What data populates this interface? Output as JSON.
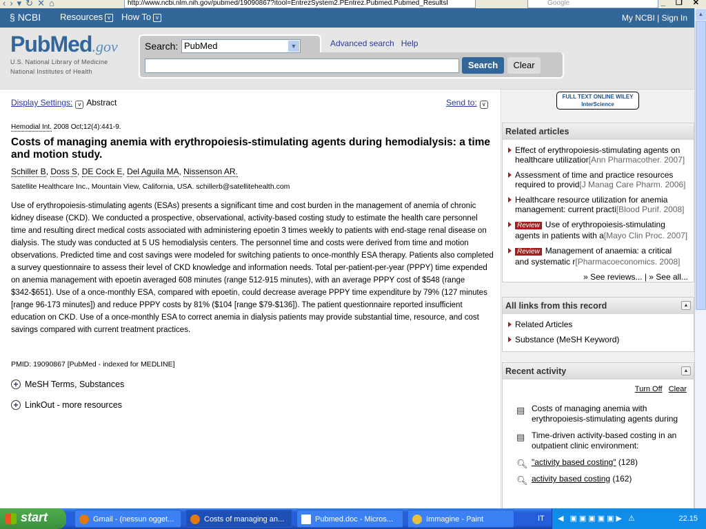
{
  "browser": {
    "url": "http://www.ncbi.nlm.nih.gov/pubmed/19090867?itool=EntrezSystem2.PEntrez.Pubmed.Pubmed_ResultsI",
    "search_placeholder": "Google"
  },
  "ncbi_bar": {
    "logo": "NCBI",
    "menus": [
      "Resources",
      "How To"
    ],
    "my_ncbi": "My NCBI",
    "sign_in": "Sign In"
  },
  "header": {
    "logo_pub": "Pub",
    "logo_med": "Med",
    "logo_gov": ".gov",
    "org1": "U.S. National Library of Medicine",
    "org2": "National Institutes of Health",
    "search_label": "Search:",
    "database": "PubMed",
    "search_value": "",
    "search_button": "Search",
    "clear_button": "Clear",
    "advanced_search": "Advanced search",
    "help": "Help"
  },
  "article": {
    "display_settings": "Display Settings:",
    "format": "Abstract",
    "send_to": "Send to:",
    "journal": "Hemodial Int.",
    "citation_rest": " 2008 Oct;12(4):441-9.",
    "title": "Costs of managing anemia with erythropoiesis-stimulating agents during hemodialysis: a time and motion study.",
    "authors": [
      "Schiller B",
      "Doss S",
      "DE Cock E",
      "Del Aguila MA",
      "Nissenson AR."
    ],
    "affiliation": "Satellite Healthcare Inc., Mountain View, California, USA. schillerb@satellitehealth.com",
    "abstract": "Use of erythropoiesis-stimulating agents (ESAs) presents a significant time and cost burden in the management of anemia of chronic kidney disease (CKD). We conducted a prospective, observational, activity-based costing study to estimate the health care personnel time and resulting direct medical costs associated with administering epoetin 3 times weekly to patients with end-stage renal disease on dialysis. The study was conducted at 5 US hemodialysis centers. The personnel time and costs were derived from time and motion observations. Predicted time and cost savings were modeled for switching patients to once-monthly ESA therapy. Patients also completed a survey questionnaire to assess their level of CKD knowledge and information needs. Total per-patient-per-year (PPPY) time expended on anemia management with epoetin averaged 608 minutes (range 512-915 minutes), with an average PPPY cost of $548 (range $342-$651). Use of a once-monthly ESA, compared with epoetin, could decrease average PPPY time expenditure by 79% (127 minutes [range 96-173 minutes]) and reduce PPPY costs by 81% ($104 [range $79-$136]). The patient questionnaire reported insufficient education on CKD. Use of a once-monthly ESA to correct anemia in dialysis patients may provide substantial time, resource, and cost savings compared with current treatment practices.",
    "pmid": "PMID: 19090867 [PubMed - indexed for MEDLINE]",
    "mesh": "MeSH Terms, Substances",
    "linkout": "LinkOut - more resources"
  },
  "sidebar": {
    "fulltext_badge": "FULL TEXT ONLINE WILEY InterScience",
    "related_title": "Related articles",
    "related": [
      {
        "review": "",
        "line1": "Effect of erythropoiesis-stimulating agents on",
        "line2": "healthcare utilizatior",
        "source": "[Ann Pharmacother. 2007]"
      },
      {
        "review": "",
        "line1": "Assessment of time and practice resources",
        "line2": "required to provid",
        "source": "[J Manag Care Pharm. 2006]"
      },
      {
        "review": "",
        "line1": "Healthcare resource utilization for anemia",
        "line2": "management: current practi",
        "source": "[Blood Purif. 2008]"
      },
      {
        "review": "Review",
        "line1": "Use of erythropoiesis-stimulating",
        "line2": "agents in patients with a",
        "source": "[Mayo Clin Proc. 2007]"
      },
      {
        "review": "Review",
        "line1": "Management of anaemia: a critical",
        "line2": "and systematic r",
        "source": "[Pharmacoeconomics. 2008]"
      }
    ],
    "see_reviews": "» See reviews...",
    "see_all": "» See all...",
    "links_title": "All links from this record",
    "links": [
      "Related Articles",
      "Substance (MeSH Keyword)"
    ],
    "recent_title": "Recent activity",
    "turn_off": "Turn Off",
    "clear": "Clear",
    "recent": [
      {
        "icon": "document-icon",
        "text": "Costs of managing anemia with erythropoiesis-stimulating agents during",
        "count": ""
      },
      {
        "icon": "document-icon",
        "text": "Time-driven activity-based costing in an outpatient clinic environment:",
        "count": ""
      },
      {
        "icon": "search-icon",
        "text": "\"activity based costing\"",
        "count": "(128)"
      },
      {
        "icon": "search-icon",
        "text": "activity based costing",
        "count": "(162)"
      }
    ]
  },
  "taskbar": {
    "start": "start",
    "tasks": [
      "Gmail - (nessun ogget...",
      "Costs of managing an...",
      "Pubmed.doc - Micros...",
      "Immagine - Paint"
    ],
    "language": "IT",
    "clock": "22.15"
  }
}
